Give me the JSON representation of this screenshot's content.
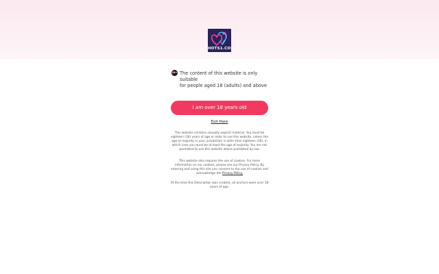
{
  "logo": {
    "text": "HOTS1.COM",
    "icon": "heart-couple-logo-icon"
  },
  "notice": {
    "badge": "18+",
    "line1": "The content of this website is only suitable",
    "line2": "for people aged 18 (adults) and above"
  },
  "enter_button": {
    "label": "I am over 18 years old"
  },
  "exit_link": {
    "label": "Exit Here"
  },
  "disclaimer": {
    "paragraph1": "This website contains sexually explicit material. You must be eighteen (18) years of age or older to use this website, unless the age of majority in your jurisdiction is older than eighteen (18), in which case you must be at least the age of majority. You are not permitted to use this website where prohibited by law.",
    "paragraph2_prefix": "This website also requires the use of cookies. For more information on our cookies, please see our Privacy Policy. By entering and using this site you consent to the use of cookies and acknowledge the ",
    "privacy_link": "Privacy Policy.",
    "paragraph3": "At the time this Description was created, all anchors were over 18 years of age."
  },
  "colors": {
    "accent": "#f23a61",
    "logo_bg": "#2a2358",
    "hero_bg": "#fbe9f0"
  }
}
